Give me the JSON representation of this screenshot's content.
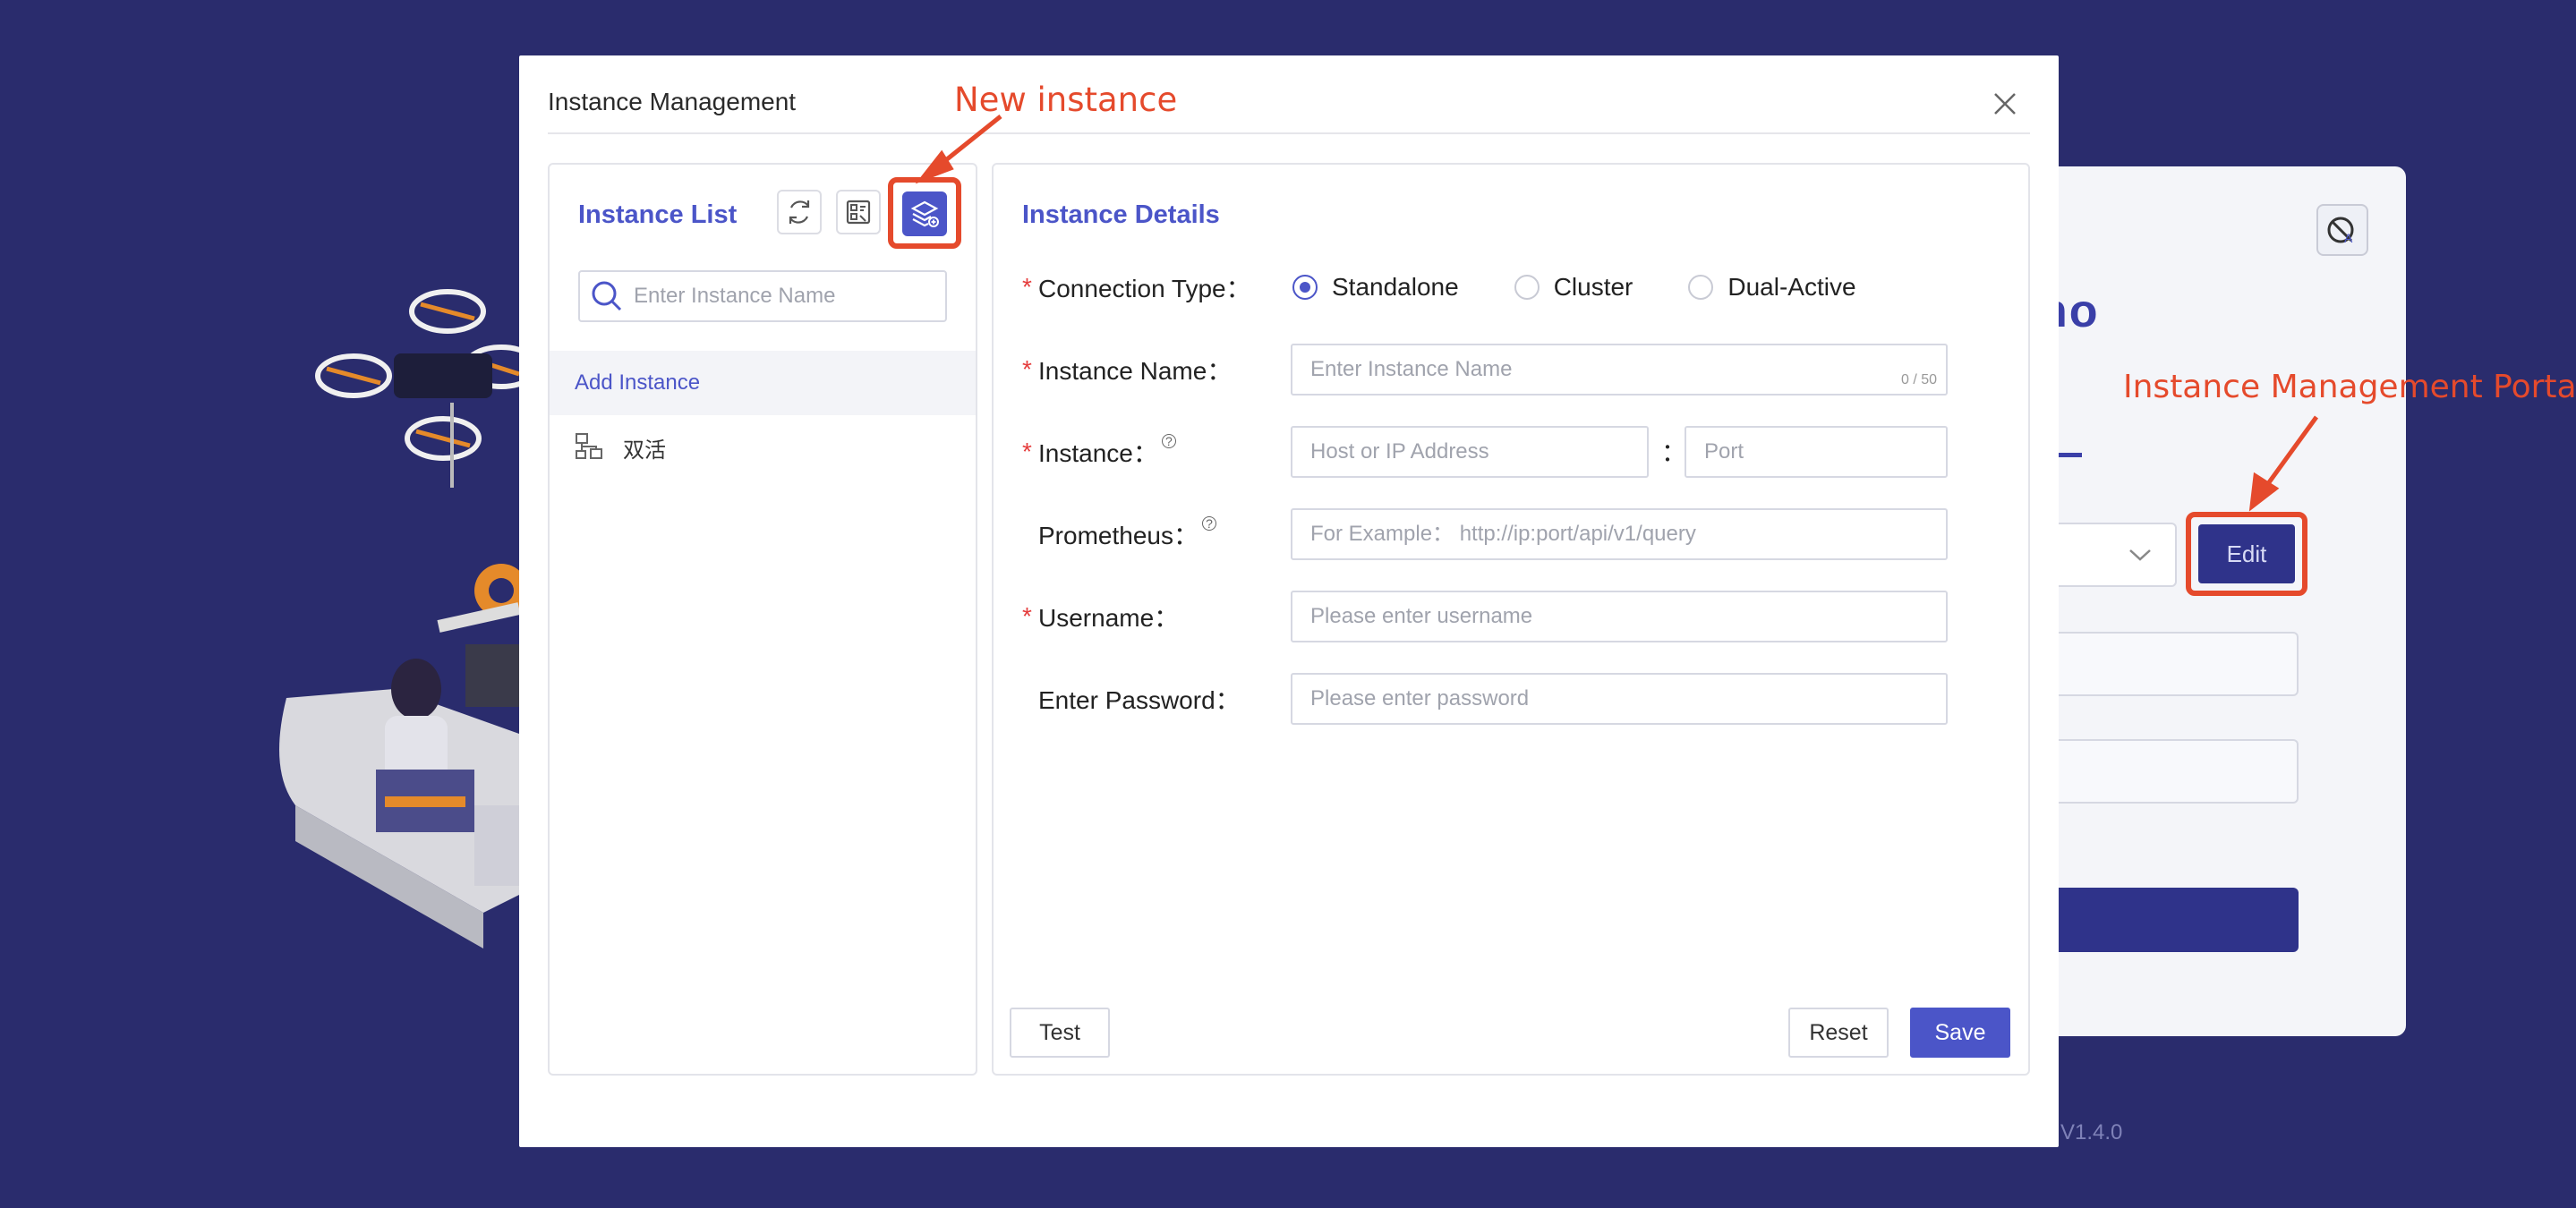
{
  "background": {
    "title_partial": "no",
    "edit_label": "Edit",
    "version": "V1.4.0"
  },
  "annotations": {
    "new_instance": "New instance",
    "portal": "Instance Management Portal",
    "color": "#e54a2c"
  },
  "modal": {
    "title": "Instance Management",
    "close_icon": "close-icon"
  },
  "instance_list": {
    "heading": "Instance List",
    "tools": [
      "refresh-icon",
      "import-icon",
      "new-instance-icon"
    ],
    "search_placeholder": "Enter Instance Name",
    "items": [
      {
        "label": "Add Instance",
        "active": true
      },
      {
        "label": "双活",
        "icon": "cluster-icon"
      }
    ]
  },
  "details": {
    "heading": "Instance Details",
    "connection_type": {
      "label": "Connection Type：",
      "options": [
        "Standalone",
        "Cluster",
        "Dual-Active"
      ],
      "selected": "Standalone"
    },
    "instance_name": {
      "label": "Instance Name：",
      "placeholder": "Enter Instance Name",
      "counter": "0 / 50"
    },
    "instance": {
      "label": "Instance：",
      "host_placeholder": "Host or IP Address",
      "sep": "：",
      "port_placeholder": "Port"
    },
    "prometheus": {
      "label": "Prometheus：",
      "placeholder": "For Example： http://ip:port/api/v1/query"
    },
    "username": {
      "label": "Username：",
      "placeholder": "Please enter username"
    },
    "password": {
      "label": "Enter Password：",
      "placeholder": "Please enter password"
    },
    "buttons": {
      "test": "Test",
      "reset": "Reset",
      "save": "Save"
    }
  },
  "colors": {
    "accent": "#4b55c8",
    "background": "#2a2c6d",
    "required": "#e53d3d"
  }
}
